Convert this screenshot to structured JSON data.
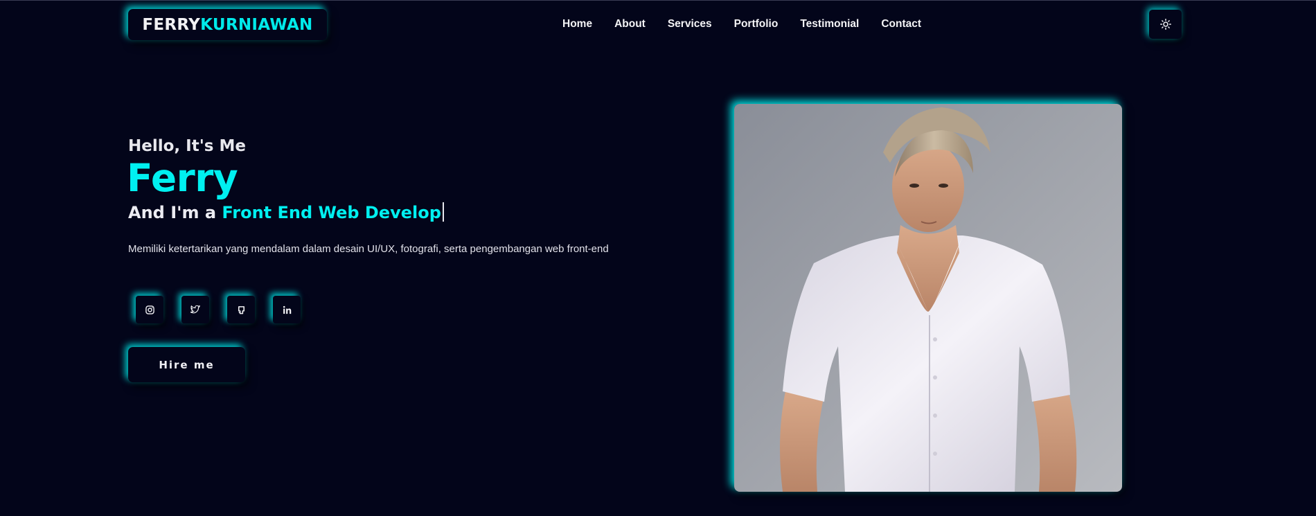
{
  "brand": {
    "first": "FERRY",
    "second": "KURNIAWAN"
  },
  "nav": {
    "items": [
      "Home",
      "About",
      "Services",
      "Portfolio",
      "Testimonial",
      "Contact"
    ]
  },
  "theme_toggle": {
    "icon": "sun-icon"
  },
  "hero": {
    "greeting": "Hello, It's Me",
    "name": "Ferry",
    "role_prefix": "And I'm a ",
    "role_typed": "Front End Web Develop",
    "description": "Memiliki ketertarikan yang mendalam dalam desain UI/UX, fotografi, serta pengembangan web front-end",
    "socials": [
      {
        "icon": "instagram-icon"
      },
      {
        "icon": "twitter-icon"
      },
      {
        "icon": "github-icon"
      },
      {
        "icon": "linkedin-icon"
      }
    ],
    "cta_label": "Hire me"
  },
  "colors": {
    "background": "#03051a",
    "accent": "#00f0f0",
    "text": "#e8e8ee"
  }
}
